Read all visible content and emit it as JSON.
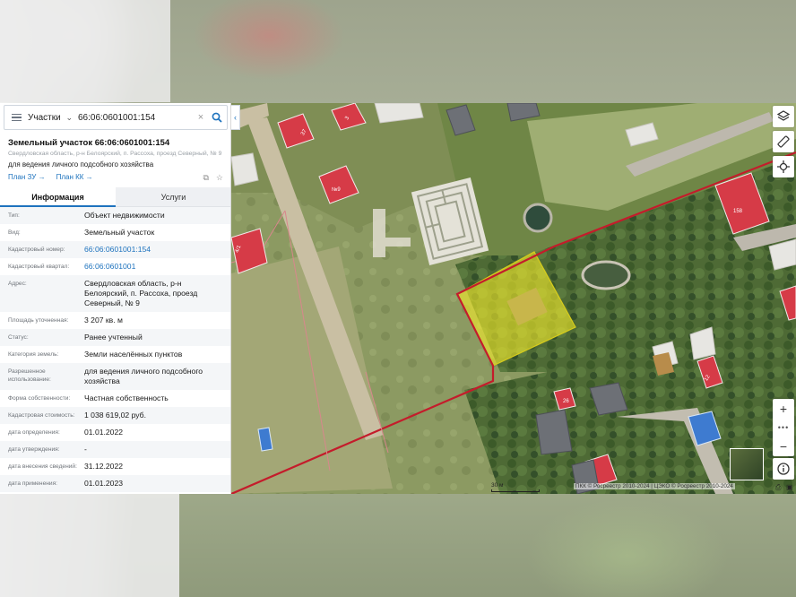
{
  "search": {
    "type_label": "Участки",
    "query": "66:06:0601001:154"
  },
  "object": {
    "title": "Земельный участок 66:06:0601001:154",
    "address_short": "Свердловская область, р-н Белоярский, п. Рассоха, проезд Северный, № 9",
    "use_short": "для ведения личного подсобного хозяйства",
    "plan_zu": "План ЗУ",
    "plan_kk": "План КК"
  },
  "tabs": [
    {
      "label": "Информация",
      "active": true
    },
    {
      "label": "Услуги",
      "active": false
    }
  ],
  "properties": [
    {
      "key": "Тип:",
      "value": "Объект недвижимости",
      "link": false
    },
    {
      "key": "Вид:",
      "value": "Земельный участок",
      "link": false
    },
    {
      "key": "Кадастровый номер:",
      "value": "66:06:0601001:154",
      "link": true
    },
    {
      "key": "Кадастровый квартал:",
      "value": "66:06:0601001",
      "link": true
    },
    {
      "key": "Адрес:",
      "value": "Свердловская область, р-н Белоярский, п. Рассоха, проезд Северный, № 9",
      "link": false
    },
    {
      "key": "Площадь уточненная:",
      "value": "3 207 кв. м",
      "link": false
    },
    {
      "key": "Статус:",
      "value": "Ранее учтенный",
      "link": false
    },
    {
      "key": "Категория земель:",
      "value": "Земли населённых пунктов",
      "link": false
    },
    {
      "key": "Разрешенное использование:",
      "value": "для ведения личного подсобного хозяйства",
      "link": false
    },
    {
      "key": "Форма собственности:",
      "value": "Частная собственность",
      "link": false
    },
    {
      "key": "Кадастровая стоимость:",
      "value": "1 038 619,02 руб.",
      "link": false
    },
    {
      "key": "дата определения:",
      "value": "01.01.2022",
      "link": false
    },
    {
      "key": "дата утверждения:",
      "value": "-",
      "link": false
    },
    {
      "key": "дата внесения сведений:",
      "value": "31.12.2022",
      "link": false
    },
    {
      "key": "дата применения:",
      "value": "01.01.2023",
      "link": false
    }
  ],
  "map": {
    "house_labels": [
      "37",
      "3",
      "№9",
      "4/1",
      "158",
      "12",
      "26"
    ],
    "scale_label": "30 м",
    "attribution": "ПКК © Росреестр 2010-2024 | ЦЭКО © Росреестр 2010-2024",
    "highlight_color": "#f3ec2c",
    "boundary_color": "#c41c2b",
    "controls": [
      "layers-icon",
      "ruler-icon",
      "locate-icon",
      "zoom-in-icon",
      "zoom-out-icon",
      "info-icon"
    ]
  }
}
